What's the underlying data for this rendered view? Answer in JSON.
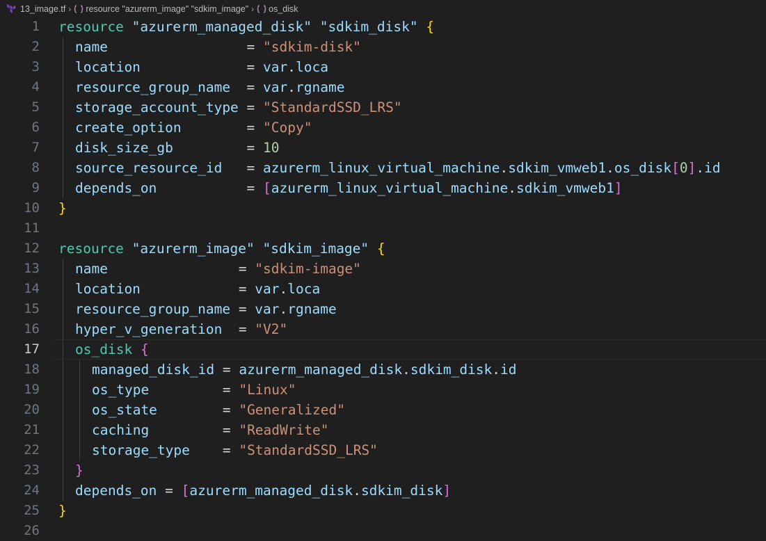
{
  "breadcrumb": {
    "file": "13_image.tf",
    "resource": "resource \"azurerm_image\" \"sdkim_image\"",
    "block": "os_disk"
  },
  "editor": {
    "current_line": 17,
    "lines": [
      {
        "n": "1",
        "indent": 0,
        "tokens": [
          {
            "t": "resource",
            "c": "kw"
          },
          {
            "t": " ",
            "c": "op"
          },
          {
            "t": "\"azurerm_managed_disk\"",
            "c": "prop"
          },
          {
            "t": " ",
            "c": "op"
          },
          {
            "t": "\"sdkim_disk\"",
            "c": "prop"
          },
          {
            "t": " ",
            "c": "op"
          },
          {
            "t": "{",
            "c": "b1"
          }
        ]
      },
      {
        "n": "2",
        "indent": 1,
        "tokens": [
          {
            "t": "name                 ",
            "c": "prop"
          },
          {
            "t": "= ",
            "c": "op"
          },
          {
            "t": "\"sdkim-disk\"",
            "c": "str"
          }
        ]
      },
      {
        "n": "3",
        "indent": 1,
        "tokens": [
          {
            "t": "location             ",
            "c": "prop"
          },
          {
            "t": "= ",
            "c": "op"
          },
          {
            "t": "var",
            "c": "var"
          },
          {
            "t": ".",
            "c": "op"
          },
          {
            "t": "loca",
            "c": "var"
          }
        ]
      },
      {
        "n": "4",
        "indent": 1,
        "tokens": [
          {
            "t": "resource_group_name  ",
            "c": "prop"
          },
          {
            "t": "= ",
            "c": "op"
          },
          {
            "t": "var",
            "c": "var"
          },
          {
            "t": ".",
            "c": "op"
          },
          {
            "t": "rgname",
            "c": "var"
          }
        ]
      },
      {
        "n": "5",
        "indent": 1,
        "tokens": [
          {
            "t": "storage_account_type ",
            "c": "prop"
          },
          {
            "t": "= ",
            "c": "op"
          },
          {
            "t": "\"StandardSSD_LRS\"",
            "c": "str"
          }
        ]
      },
      {
        "n": "6",
        "indent": 1,
        "tokens": [
          {
            "t": "create_option        ",
            "c": "prop"
          },
          {
            "t": "= ",
            "c": "op"
          },
          {
            "t": "\"Copy\"",
            "c": "str"
          }
        ]
      },
      {
        "n": "7",
        "indent": 1,
        "tokens": [
          {
            "t": "disk_size_gb         ",
            "c": "prop"
          },
          {
            "t": "= ",
            "c": "op"
          },
          {
            "t": "10",
            "c": "num"
          }
        ]
      },
      {
        "n": "8",
        "indent": 1,
        "tokens": [
          {
            "t": "source_resource_id   ",
            "c": "prop"
          },
          {
            "t": "= ",
            "c": "op"
          },
          {
            "t": "azurerm_linux_virtual_machine",
            "c": "var"
          },
          {
            "t": ".",
            "c": "op"
          },
          {
            "t": "sdkim_vmweb1",
            "c": "var"
          },
          {
            "t": ".",
            "c": "op"
          },
          {
            "t": "os_disk",
            "c": "var"
          },
          {
            "t": "[",
            "c": "b2"
          },
          {
            "t": "0",
            "c": "num"
          },
          {
            "t": "]",
            "c": "b2"
          },
          {
            "t": ".",
            "c": "op"
          },
          {
            "t": "id",
            "c": "var"
          }
        ]
      },
      {
        "n": "9",
        "indent": 1,
        "tokens": [
          {
            "t": "depends_on           ",
            "c": "prop"
          },
          {
            "t": "= ",
            "c": "op"
          },
          {
            "t": "[",
            "c": "b2"
          },
          {
            "t": "azurerm_linux_virtual_machine",
            "c": "var"
          },
          {
            "t": ".",
            "c": "op"
          },
          {
            "t": "sdkim_vmweb1",
            "c": "var"
          },
          {
            "t": "]",
            "c": "b2"
          }
        ]
      },
      {
        "n": "10",
        "indent": 0,
        "tokens": [
          {
            "t": "}",
            "c": "b1"
          }
        ]
      },
      {
        "n": "11",
        "indent": 0,
        "tokens": []
      },
      {
        "n": "12",
        "indent": 0,
        "tokens": [
          {
            "t": "resource",
            "c": "kw"
          },
          {
            "t": " ",
            "c": "op"
          },
          {
            "t": "\"azurerm_image\"",
            "c": "prop"
          },
          {
            "t": " ",
            "c": "op"
          },
          {
            "t": "\"sdkim_image\"",
            "c": "prop"
          },
          {
            "t": " ",
            "c": "op"
          },
          {
            "t": "{",
            "c": "b1"
          }
        ]
      },
      {
        "n": "13",
        "indent": 1,
        "tokens": [
          {
            "t": "name                ",
            "c": "prop"
          },
          {
            "t": "= ",
            "c": "op"
          },
          {
            "t": "\"sdkim-image\"",
            "c": "str"
          }
        ]
      },
      {
        "n": "14",
        "indent": 1,
        "tokens": [
          {
            "t": "location            ",
            "c": "prop"
          },
          {
            "t": "= ",
            "c": "op"
          },
          {
            "t": "var",
            "c": "var"
          },
          {
            "t": ".",
            "c": "op"
          },
          {
            "t": "loca",
            "c": "var"
          }
        ]
      },
      {
        "n": "15",
        "indent": 1,
        "tokens": [
          {
            "t": "resource_group_name ",
            "c": "prop"
          },
          {
            "t": "= ",
            "c": "op"
          },
          {
            "t": "var",
            "c": "var"
          },
          {
            "t": ".",
            "c": "op"
          },
          {
            "t": "rgname",
            "c": "var"
          }
        ]
      },
      {
        "n": "16",
        "indent": 1,
        "tokens": [
          {
            "t": "hyper_v_generation  ",
            "c": "prop"
          },
          {
            "t": "= ",
            "c": "op"
          },
          {
            "t": "\"V2\"",
            "c": "str"
          }
        ]
      },
      {
        "n": "17",
        "indent": 1,
        "tokens": [
          {
            "t": "os_disk",
            "c": "blk"
          },
          {
            "t": " ",
            "c": "op"
          },
          {
            "t": "{",
            "c": "b2"
          }
        ]
      },
      {
        "n": "18",
        "indent": 2,
        "tokens": [
          {
            "t": "managed_disk_id ",
            "c": "prop"
          },
          {
            "t": "= ",
            "c": "op"
          },
          {
            "t": "azurerm_managed_disk",
            "c": "var"
          },
          {
            "t": ".",
            "c": "op"
          },
          {
            "t": "sdkim_disk",
            "c": "var"
          },
          {
            "t": ".",
            "c": "op"
          },
          {
            "t": "id",
            "c": "var"
          }
        ]
      },
      {
        "n": "19",
        "indent": 2,
        "tokens": [
          {
            "t": "os_type         ",
            "c": "prop"
          },
          {
            "t": "= ",
            "c": "op"
          },
          {
            "t": "\"Linux\"",
            "c": "str"
          }
        ]
      },
      {
        "n": "20",
        "indent": 2,
        "tokens": [
          {
            "t": "os_state        ",
            "c": "prop"
          },
          {
            "t": "= ",
            "c": "op"
          },
          {
            "t": "\"Generalized\"",
            "c": "str"
          }
        ]
      },
      {
        "n": "21",
        "indent": 2,
        "tokens": [
          {
            "t": "caching         ",
            "c": "prop"
          },
          {
            "t": "= ",
            "c": "op"
          },
          {
            "t": "\"ReadWrite\"",
            "c": "str"
          }
        ]
      },
      {
        "n": "22",
        "indent": 2,
        "tokens": [
          {
            "t": "storage_type    ",
            "c": "prop"
          },
          {
            "t": "= ",
            "c": "op"
          },
          {
            "t": "\"StandardSSD_LRS\"",
            "c": "str"
          }
        ]
      },
      {
        "n": "23",
        "indent": 1,
        "tokens": [
          {
            "t": "}",
            "c": "b2"
          }
        ]
      },
      {
        "n": "24",
        "indent": 1,
        "tokens": [
          {
            "t": "depends_on ",
            "c": "prop"
          },
          {
            "t": "= ",
            "c": "op"
          },
          {
            "t": "[",
            "c": "b2"
          },
          {
            "t": "azurerm_managed_disk",
            "c": "var"
          },
          {
            "t": ".",
            "c": "op"
          },
          {
            "t": "sdkim_disk",
            "c": "var"
          },
          {
            "t": "]",
            "c": "b2"
          }
        ]
      },
      {
        "n": "25",
        "indent": 0,
        "tokens": [
          {
            "t": "}",
            "c": "b1"
          }
        ]
      },
      {
        "n": "26",
        "indent": 0,
        "tokens": []
      }
    ]
  }
}
